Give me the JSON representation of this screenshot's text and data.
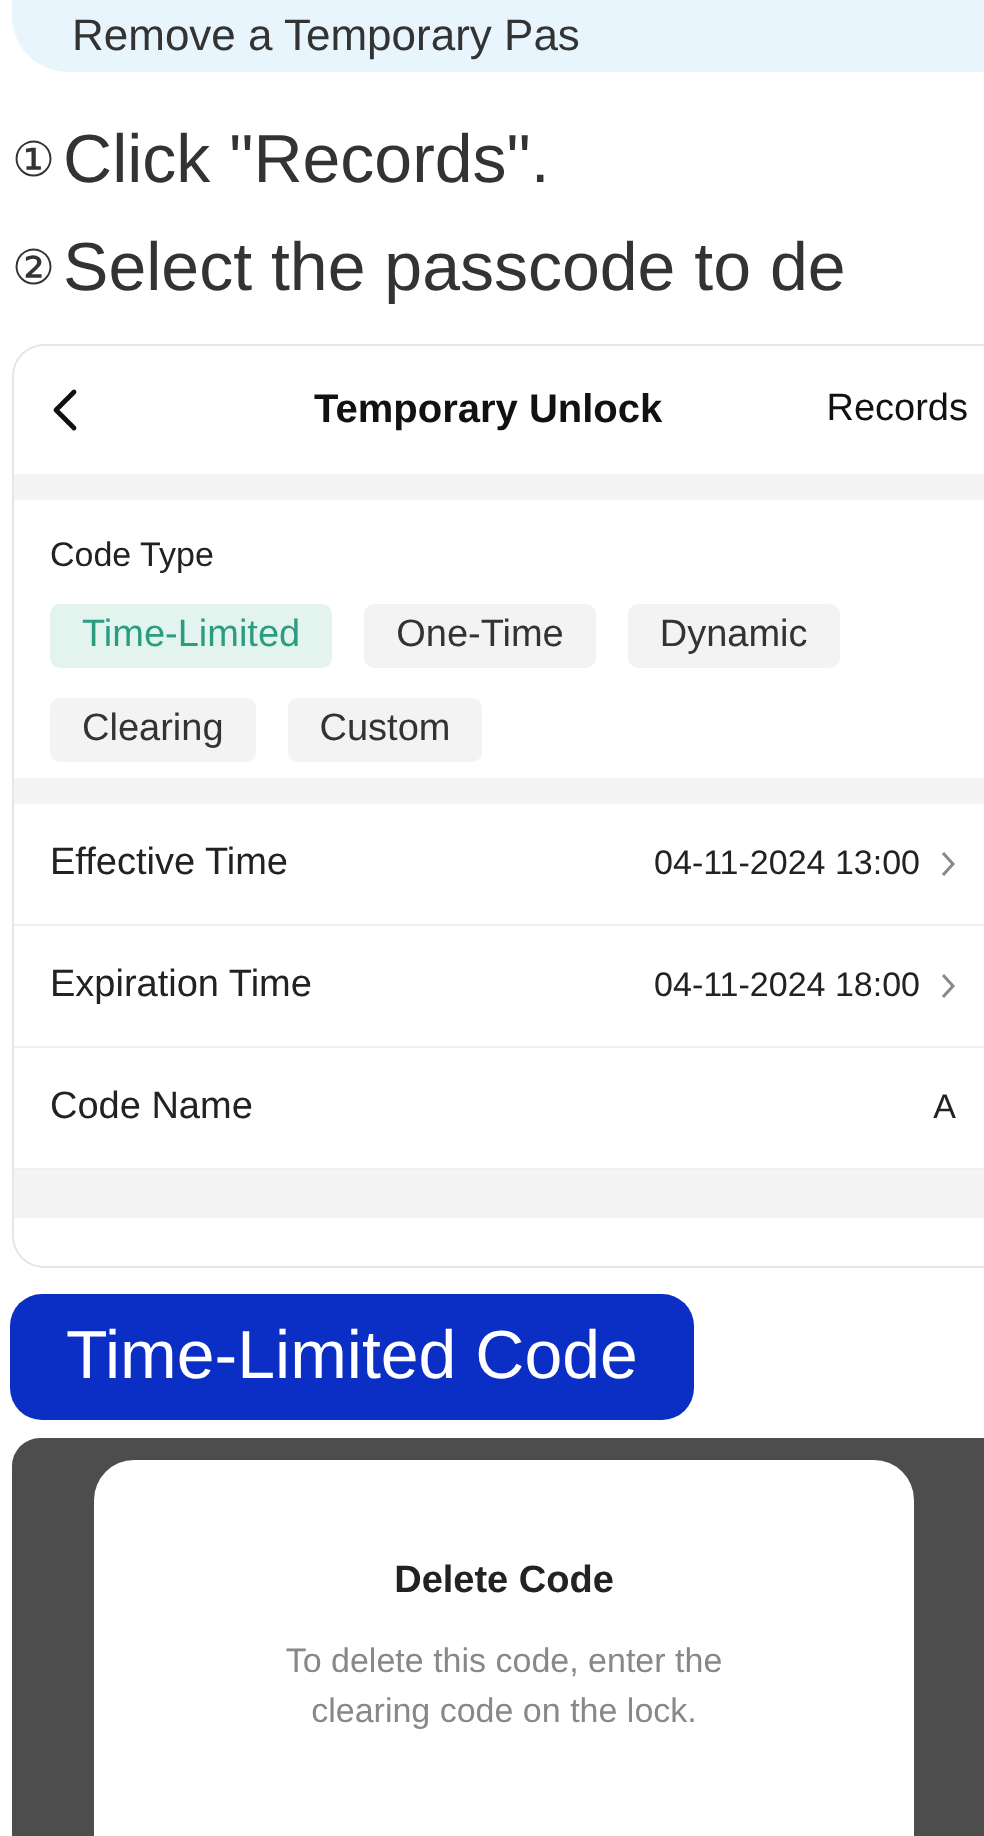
{
  "banner": {
    "title": "Remove a Temporary Pas"
  },
  "steps": [
    {
      "marker": "①",
      "text": "Click \"Records\"."
    },
    {
      "marker": "②",
      "text": "Select the passcode to de"
    }
  ],
  "app": {
    "nav": {
      "title": "Temporary Unlock",
      "action": "Records"
    },
    "code_type": {
      "label": "Code Type",
      "options": [
        {
          "label": "Time-Limited",
          "selected": true
        },
        {
          "label": "One-Time",
          "selected": false
        },
        {
          "label": "Dynamic",
          "selected": false
        },
        {
          "label": "Clearing",
          "selected": false
        },
        {
          "label": "Custom",
          "selected": false
        }
      ]
    },
    "fields": [
      {
        "label": "Effective Time",
        "value": "04-11-2024 13:00",
        "kind": "picker"
      },
      {
        "label": "Expiration Time",
        "value": "04-11-2024 18:00",
        "kind": "picker"
      },
      {
        "label": "Code Name",
        "value": "A",
        "kind": "text"
      }
    ]
  },
  "caption": "Time-Limited Code",
  "dialog": {
    "title": "Delete Code",
    "message": "To delete this code, enter the clearing code on the lock."
  }
}
